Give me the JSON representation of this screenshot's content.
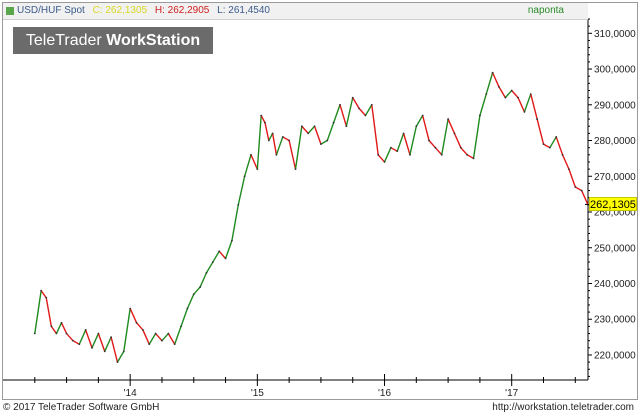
{
  "header": {
    "instrument": "USD/HUF Spot",
    "close_label": "C: 262,1305",
    "high_label": "H: 262,2905",
    "low_label": "L: 261,4540",
    "timeframe": "naponta"
  },
  "logo": {
    "part1": "TeleTrader ",
    "part2": "WorkStation"
  },
  "footer": {
    "copyright": "© 2017 TeleTrader Software GmbH",
    "url": "http://workstation.teletrader.com"
  },
  "colors": {
    "up": "#1e8a1e",
    "down": "#e01818",
    "badge": "#ffff00"
  },
  "chart_data": {
    "type": "line",
    "series": [
      {
        "name": "USD/HUF Spot",
        "x": [
          2013.25,
          2013.3,
          2013.34,
          2013.38,
          2013.42,
          2013.46,
          2013.5,
          2013.55,
          2013.6,
          2013.65,
          2013.7,
          2013.75,
          2013.8,
          2013.85,
          2013.9,
          2013.95,
          2014.0,
          2014.05,
          2014.1,
          2014.15,
          2014.2,
          2014.25,
          2014.3,
          2014.35,
          2014.4,
          2014.45,
          2014.5,
          2014.55,
          2014.6,
          2014.65,
          2014.7,
          2014.75,
          2014.8,
          2014.85,
          2014.9,
          2014.95,
          2015.0,
          2015.03,
          2015.06,
          2015.09,
          2015.12,
          2015.15,
          2015.2,
          2015.25,
          2015.3,
          2015.35,
          2015.4,
          2015.45,
          2015.5,
          2015.55,
          2015.6,
          2015.65,
          2015.7,
          2015.75,
          2015.8,
          2015.85,
          2015.9,
          2015.95,
          2016.0,
          2016.05,
          2016.1,
          2016.15,
          2016.2,
          2016.25,
          2016.3,
          2016.35,
          2016.4,
          2016.45,
          2016.5,
          2016.55,
          2016.6,
          2016.65,
          2016.7,
          2016.75,
          2016.8,
          2016.85,
          2016.9,
          2016.95,
          2017.0,
          2017.05,
          2017.1,
          2017.15,
          2017.2,
          2017.25,
          2017.3,
          2017.35,
          2017.4,
          2017.45,
          2017.5,
          2017.55,
          2017.6
        ],
        "values": [
          226,
          238,
          236,
          228,
          226,
          229,
          226,
          224,
          223,
          227,
          222,
          226,
          221,
          225,
          218,
          221,
          233,
          229,
          227,
          223,
          226,
          224,
          226,
          223,
          228,
          233,
          237,
          239,
          243,
          246,
          249,
          247,
          252,
          262,
          270,
          276,
          272,
          287,
          285,
          280,
          282,
          276,
          281,
          280,
          272,
          284,
          282,
          284,
          279,
          280,
          285,
          290,
          284,
          292,
          289,
          287,
          290,
          276,
          274,
          278,
          277,
          282,
          276,
          284,
          287,
          280,
          278,
          276,
          286,
          282,
          278,
          276,
          275,
          287,
          293,
          299,
          295,
          292,
          294,
          292,
          288,
          293,
          286,
          279,
          278,
          281,
          276,
          272,
          267,
          266,
          262
        ]
      }
    ],
    "x_ticks": [
      {
        "value": 2014.0,
        "label": "'14"
      },
      {
        "value": 2015.0,
        "label": "'15"
      },
      {
        "value": 2016.0,
        "label": "'16"
      },
      {
        "value": 2017.0,
        "label": "'17"
      }
    ],
    "y_ticks": [
      {
        "value": 220,
        "label": "220,0000"
      },
      {
        "value": 230,
        "label": "230,0000"
      },
      {
        "value": 240,
        "label": "240,0000"
      },
      {
        "value": 250,
        "label": "250,0000"
      },
      {
        "value": 260,
        "label": "260,0000"
      },
      {
        "value": 270,
        "label": "270,0000"
      },
      {
        "value": 280,
        "label": "280,0000"
      },
      {
        "value": 290,
        "label": "290,0000"
      },
      {
        "value": 300,
        "label": "300,0000"
      },
      {
        "value": 310,
        "label": "310,0000"
      }
    ],
    "last_price": {
      "value": 262.1305,
      "label": "262,1305"
    },
    "xlim": [
      2013.0,
      2017.6
    ],
    "ylim": [
      213,
      314
    ],
    "grid": false,
    "legend": "top-left"
  }
}
